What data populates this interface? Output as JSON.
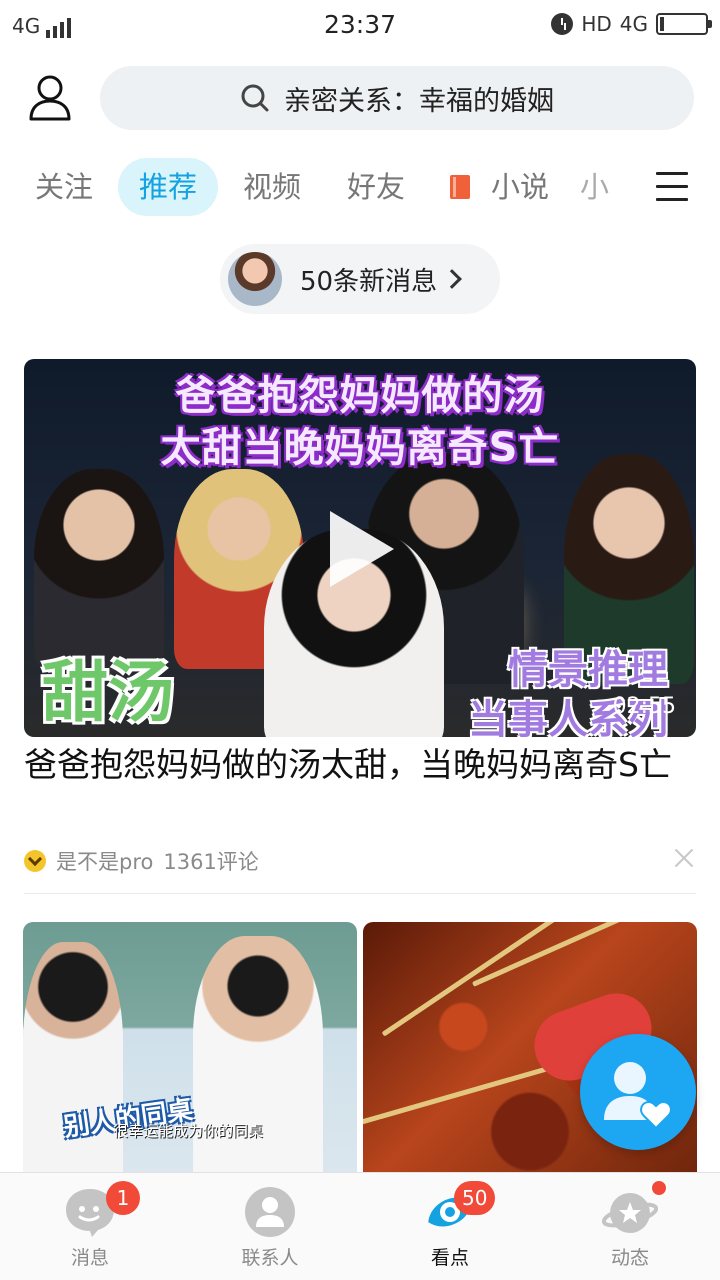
{
  "status_bar": {
    "network": "4G",
    "time": "23:37",
    "hd": "HD",
    "network_right": "4G"
  },
  "header": {
    "search_text": "亲密关系：幸福的婚姻"
  },
  "tabs": [
    {
      "label": "关注",
      "active": false
    },
    {
      "label": "推荐",
      "active": true
    },
    {
      "label": "视频",
      "active": false
    },
    {
      "label": "好友",
      "active": false
    },
    {
      "label": "小说",
      "active": false
    },
    {
      "label": "小",
      "active": false
    }
  ],
  "new_messages": {
    "text": "50条新消息"
  },
  "feed": {
    "video": {
      "overlay_line1": "爸爸抱怨妈妈做的汤",
      "overlay_line2": "太甜当晚妈妈离奇S亡",
      "overlay_left": "甜汤",
      "overlay_right1": "情景推理",
      "overlay_right2": "当事人系列",
      "duration": "02:55",
      "title": "爸爸抱怨妈妈做的汤太甜，当晚妈妈离奇S亡",
      "author": "是不是pro",
      "comments": "1361评论"
    },
    "thumbnails": [
      {
        "caption": "别人的同桌",
        "subtitle": "很幸运能成为你的同桌"
      },
      {
        "caption": ""
      }
    ]
  },
  "bottom_nav": [
    {
      "label": "消息",
      "badge": "1",
      "active": false,
      "icon": "chat-bubble-icon"
    },
    {
      "label": "联系人",
      "badge": "",
      "active": false,
      "icon": "contacts-icon"
    },
    {
      "label": "看点",
      "badge": "50",
      "active": true,
      "icon": "eye-icon"
    },
    {
      "label": "动态",
      "badge": "",
      "dot": true,
      "active": false,
      "icon": "planet-star-icon"
    }
  ],
  "colors": {
    "accent": "#14a3e0",
    "badge": "#f24a38",
    "tab_active_bg": "#d9f4fb"
  }
}
